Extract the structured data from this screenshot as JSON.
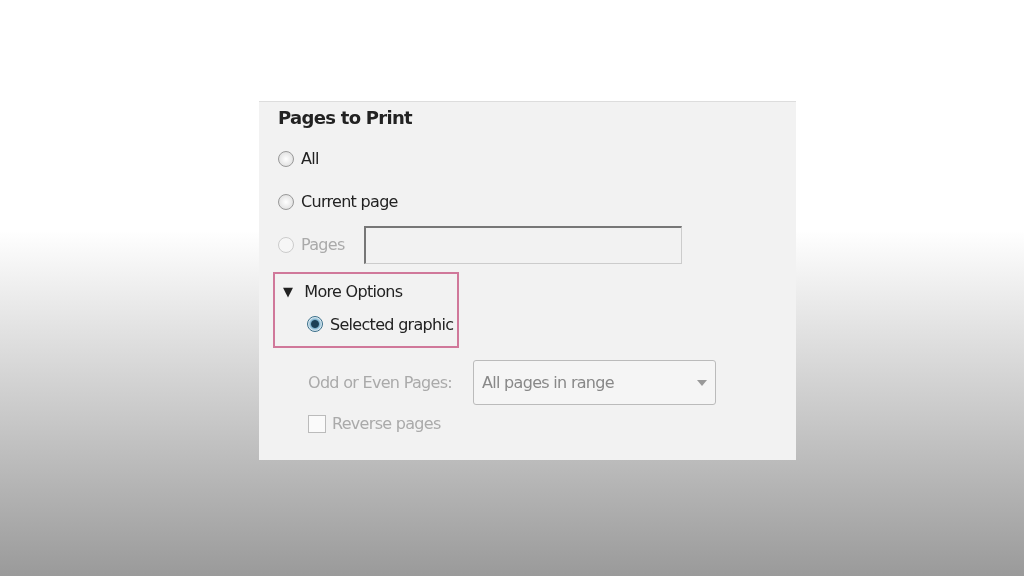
{
  "section_title": "Pages to Print",
  "page_options": [
    {
      "label": "All",
      "selected": false,
      "disabled": false
    },
    {
      "label": "Current page",
      "selected": false,
      "disabled": false
    },
    {
      "label": "Pages",
      "selected": false,
      "disabled": true
    }
  ],
  "more_options": {
    "glyph": "▼",
    "label": "More Options",
    "expanded": true,
    "highlighted": true,
    "options": [
      {
        "label": "Selected graphic",
        "selected": true,
        "disabled": false
      }
    ]
  },
  "odd_even": {
    "label": "Odd or Even Pages:",
    "value": "All pages in range",
    "disabled": true
  },
  "reverse_pages": {
    "label": "Reverse pages",
    "checked": false,
    "disabled": true
  }
}
